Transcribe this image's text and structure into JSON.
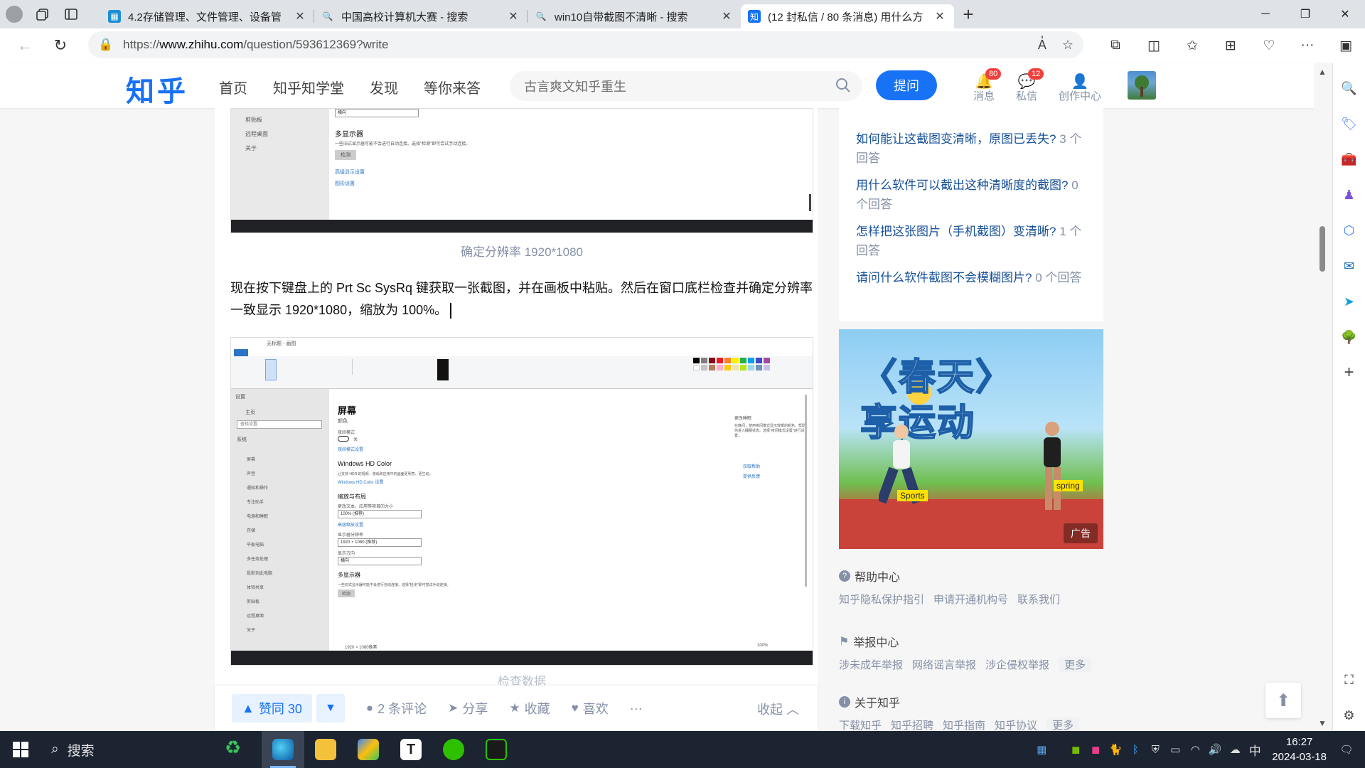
{
  "browser": {
    "tabs": [
      {
        "title": "4.2存储管理、文件管理、设备管",
        "favicon": "calendar-favicon",
        "color": "#1a8fd6",
        "active": false
      },
      {
        "title": "中国高校计算机大赛 - 搜索",
        "favicon": "search-favicon",
        "color": "#1a7be0",
        "active": false
      },
      {
        "title": "win10自带截图不清晰 - 搜索",
        "favicon": "search-favicon",
        "color": "#1a7be0",
        "active": false
      },
      {
        "title": "(12 封私信 / 80 条消息) 用什么方",
        "favicon": "zhihu-favicon",
        "color": "#1772f6",
        "active": true
      }
    ],
    "url_prefix": "https://",
    "url_domain": "www.zhihu.com",
    "url_path": "/question/593612369?write"
  },
  "zhihu_header": {
    "logo": "知乎",
    "nav": [
      "首页",
      "知乎知学堂",
      "发现",
      "等你来答"
    ],
    "search_placeholder": "古言爽文知乎重生",
    "ask_button": "提问",
    "messages_label": "消息",
    "messages_count": "80",
    "dm_label": "私信",
    "dm_count": "12",
    "creator_label": "创作中心"
  },
  "editor": {
    "caption1": "确定分辨率 1920*1080",
    "paragraph": "现在按下键盘上的 Prt Sc SysRq 键获取一张截图，并在画板中粘贴。然后在窗口底栏检查并确定分辨率一致显示 1920*1080，缩放为 100%。",
    "caption2_partial": "检查数据",
    "screenshot1": {
      "items": [
        "剪贴板",
        "远程桌面",
        "关于"
      ],
      "select_value": "横向",
      "section": "多显示器",
      "desc": "一些旧式显示器可能不会进行自动连接。选择\"检测\"即可尝试手动连接。",
      "button": "检测",
      "link1": "高级显示设置",
      "link2": "图形设置"
    },
    "screenshot2": {
      "window_title": "无标题 - 画图",
      "sidebar_title": "设置",
      "home": "主页",
      "find_setting": "查找设置",
      "system": "系统",
      "nav_items": [
        "屏幕",
        "声音",
        "通知和操作",
        "专注助手",
        "电源和睡眠",
        "存储",
        "平板电脑",
        "多任务处理",
        "投影到此电脑",
        "体验共享",
        "剪贴板",
        "远程桌面",
        "关于"
      ],
      "heading": "屏幕",
      "color": "颜色",
      "night_light": "夜间模式",
      "night_light_state": "关",
      "night_light_link": "夜间模式设置",
      "hd_color": "Windows HD Color",
      "hd_desc": "让支持 HDR 的视频、游戏和应用中的画面更明亮、更生动。",
      "hd_link": "Windows HD Color 设置",
      "scale_layout": "缩放与布局",
      "scale_label": "更改文本、应用等项目的大小",
      "scale_value": "100% (推荐)",
      "adv_scale": "高级缩放设置",
      "resolution_label": "显示器分辨率",
      "resolution_value": "1920 × 1080 (推荐)",
      "orientation_label": "显示方向",
      "orientation_value": "横向",
      "multi_display": "多显示器",
      "multi_desc": "一些旧式显示器可能不会进行自动连接。选择\"检测\"即可尝试手动连接。",
      "detect": "检测",
      "side_title": "更改睡眠",
      "side_desc": "在晚间，使用夜间模式显示较暖的颜色，帮助你进入睡眠状态。选择\"夜间模式设置\"进行设置。",
      "help": "获取帮助",
      "feedback": "提供反馈",
      "status_res": "1920 × 1080像素",
      "status_zoom": "100%"
    }
  },
  "actions": {
    "upvote": "赞同 30",
    "comments": "2 条评论",
    "share": "分享",
    "favorite": "收藏",
    "like": "喜欢",
    "more": "···",
    "collapse": "收起"
  },
  "related": [
    {
      "q": "如何能让这截图变清晰，原图已丢失?",
      "n": "3 个回答"
    },
    {
      "q": "用什么软件可以截出这种清晰度的截图?",
      "n": "0 个回答"
    },
    {
      "q": "怎样把这张图片（手机截图）变清晰?",
      "n": "1 个回答"
    },
    {
      "q": "请问什么软件截图不会模糊图片?",
      "n": "0 个回答"
    }
  ],
  "ad": {
    "headline1": "〈春天〉",
    "headline2": "享运动",
    "tag1": "Sports",
    "tag2": "spring",
    "label": "广告"
  },
  "footer": {
    "help_title": "帮助中心",
    "help_links": [
      "知乎隐私保护指引",
      "申请开通机构号",
      "联系我们"
    ],
    "report_title": "举报中心",
    "report_links": [
      "涉未成年举报",
      "网络谣言举报",
      "涉企侵权举报"
    ],
    "report_more": "更多",
    "about_title": "关于知乎",
    "about_links": [
      "下载知乎",
      "知乎招聘",
      "知乎指南",
      "知乎协议"
    ],
    "about_more": "更多"
  },
  "taskbar": {
    "search": "搜索",
    "time": "16:27",
    "date": "2024-03-18",
    "ime": "中"
  }
}
